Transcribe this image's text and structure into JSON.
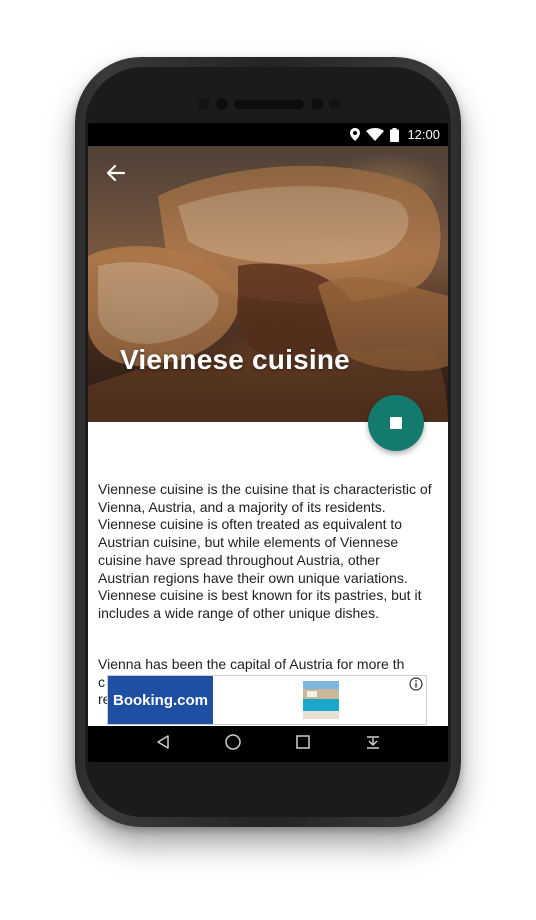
{
  "status_bar": {
    "time": "12:00",
    "icons": [
      "location-icon",
      "wifi-icon",
      "battery-icon"
    ]
  },
  "app_bar": {
    "back_icon": "arrow-back-icon"
  },
  "article": {
    "title": "Viennese cuisine",
    "paragraphs": [
      "Viennese cuisine is the cuisine that is characteristic of Vienna, Austria, and a majority of its residents. Viennese cuisine is often treated as equivalent to Austrian cuisine, but while elements of Viennese cuisine have spread throughout Austria, other Austrian regions have their own unique variations. Viennese cuisine is best known for its pastries, but it includes a wide range of other unique dishes.",
      "Vienna has been the capital of Austria for more th"
    ]
  },
  "fab": {
    "icon": "stop-icon"
  },
  "ad_banner": {
    "brand": "Booking.com",
    "info_icon": "info-icon"
  },
  "nav_bar": {
    "buttons": [
      "back-triangle-icon",
      "home-circle-icon",
      "recents-square-icon",
      "notification-drawer-icon"
    ]
  },
  "colors": {
    "accent": "#157a6e",
    "ad_brand": "#1e4fa3"
  }
}
